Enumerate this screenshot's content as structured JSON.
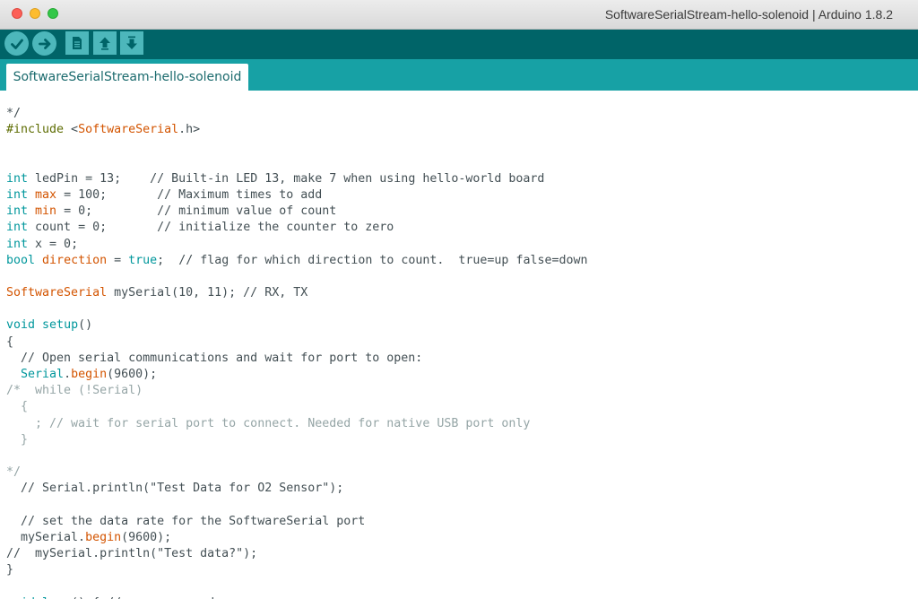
{
  "window": {
    "title": "SoftwareSerialStream-hello-solenoid | Arduino 1.8.2"
  },
  "toolbar": {
    "buttons": [
      {
        "name": "verify",
        "icon": "check-icon"
      },
      {
        "name": "upload",
        "icon": "arrow-right-icon"
      },
      {
        "name": "new",
        "icon": "document-icon"
      },
      {
        "name": "open",
        "icon": "arrow-up-icon"
      },
      {
        "name": "save",
        "icon": "arrow-down-icon"
      }
    ]
  },
  "tabs": [
    {
      "label": "SoftwareSerialStream-hello-solenoid",
      "active": true
    }
  ],
  "colors": {
    "toolbar_bg": "#006468",
    "tabbar_bg": "#17a1a5",
    "button_bg": "#4db7bb",
    "keyword": "#00979c",
    "function": "#d35400",
    "comment": "#434f54",
    "grey_comment": "#95a5a6"
  },
  "editor": {
    "lines": [
      [
        [
          "cm",
          "*/"
        ]
      ],
      [
        [
          "dir",
          "#include"
        ],
        [
          "",
          " <"
        ],
        [
          "fn",
          "SoftwareSerial"
        ],
        [
          "",
          ".h>"
        ]
      ],
      [],
      [],
      [
        [
          "kw",
          "int"
        ],
        [
          "",
          " ledPin = 13;    // Built-in LED 13, make 7 when using hello-world board"
        ]
      ],
      [
        [
          "kw",
          "int"
        ],
        [
          "",
          " "
        ],
        [
          "fn",
          "max"
        ],
        [
          "",
          " = 100;       // Maximum times to add"
        ]
      ],
      [
        [
          "kw",
          "int"
        ],
        [
          "",
          " "
        ],
        [
          "fn",
          "min"
        ],
        [
          "",
          " = 0;         // minimum value of count"
        ]
      ],
      [
        [
          "kw",
          "int"
        ],
        [
          "",
          " count = 0;       // initialize the counter to zero"
        ]
      ],
      [
        [
          "kw",
          "int"
        ],
        [
          "",
          " x = 0;"
        ]
      ],
      [
        [
          "kw",
          "bool"
        ],
        [
          "",
          " "
        ],
        [
          "fn",
          "direction"
        ],
        [
          "",
          " = "
        ],
        [
          "lit",
          "true"
        ],
        [
          "",
          ";  // flag for which direction to count.  true=up false=down"
        ]
      ],
      [],
      [
        [
          "fn",
          "SoftwareSerial"
        ],
        [
          "",
          " mySerial(10, 11); // RX, TX"
        ]
      ],
      [],
      [
        [
          "kw",
          "void"
        ],
        [
          "",
          " "
        ],
        [
          "kw",
          "setup"
        ],
        [
          "",
          "()"
        ]
      ],
      [
        [
          "",
          "{"
        ]
      ],
      [
        [
          "",
          "  // Open serial communications and wait for port to open:"
        ]
      ],
      [
        [
          "",
          "  "
        ],
        [
          "kw",
          "Serial"
        ],
        [
          "",
          "."
        ],
        [
          "fn",
          "begin"
        ],
        [
          "",
          "(9600);"
        ]
      ],
      [
        [
          "gc",
          "/*  while (!Serial)"
        ]
      ],
      [
        [
          "gc",
          "  {"
        ]
      ],
      [
        [
          "gc",
          "    ; // wait for serial port to connect. Needed for native USB port only"
        ]
      ],
      [
        [
          "gc",
          "  }"
        ]
      ],
      [],
      [
        [
          "gc",
          "*/"
        ]
      ],
      [
        [
          "",
          "  // Serial.println(\"Test Data for O2 Sensor\");"
        ]
      ],
      [],
      [
        [
          "",
          "  // set the data rate for the SoftwareSerial port"
        ]
      ],
      [
        [
          "",
          "  mySerial."
        ],
        [
          "fn",
          "begin"
        ],
        [
          "",
          "(9600);"
        ]
      ],
      [
        [
          "",
          "//  mySerial.println(\"Test data?\");"
        ]
      ],
      [
        [
          "",
          "}"
        ]
      ],
      [],
      [
        [
          "kw",
          "void"
        ],
        [
          "",
          " "
        ],
        [
          "kw",
          "loop"
        ],
        [
          "",
          "() { // run over and over"
        ]
      ]
    ]
  }
}
